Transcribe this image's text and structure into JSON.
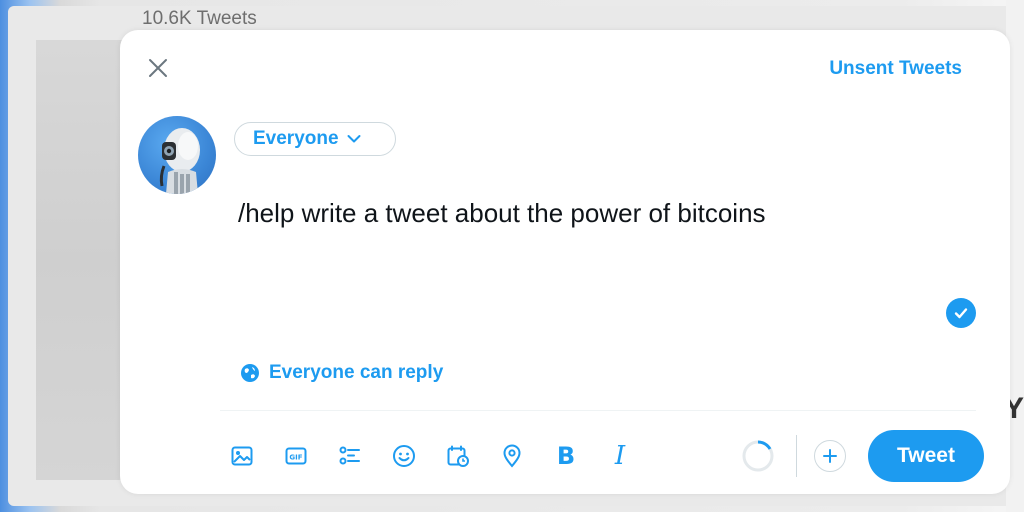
{
  "background": {
    "tweets_count": "10.6K Tweets"
  },
  "composer": {
    "close_icon": "close-icon",
    "unsent_tweets_label": "Unsent Tweets",
    "audience_label": "Everyone",
    "tweet_text": "/help write a tweet about the power of bitcoins",
    "reply_setting_label": "Everyone can reply",
    "tweet_button_label": "Tweet",
    "toolbar_icons": [
      "image-icon",
      "gif-icon",
      "poll-icon",
      "emoji-icon",
      "schedule-icon",
      "location-icon",
      "bold-icon",
      "italic-icon"
    ],
    "bold_glyph": "B",
    "italic_glyph": "I",
    "accent_color": "#1d9bf0"
  }
}
